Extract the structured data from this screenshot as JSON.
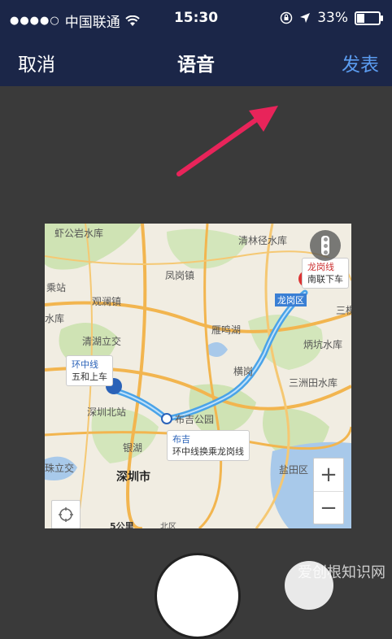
{
  "status_bar": {
    "signal": "●●●●○",
    "carrier": "中国联通",
    "time": "15:30",
    "battery": "33%",
    "battery_level": 0.33
  },
  "nav": {
    "cancel": "取消",
    "title": "语音",
    "publish": "发表"
  },
  "map": {
    "places": {
      "p1": "虾公岩水库",
      "p2": "清林径水库",
      "p3": "凤岗镇",
      "p4": "观澜镇",
      "p5": "水库",
      "p6": "雁鸣湖",
      "p7": "炳坑水库",
      "p8": "清湖立交",
      "p9": "横岗",
      "p10": "三洲田水库",
      "p11": "深圳北站",
      "p12": "布吉公园",
      "p13": "银湖",
      "p14": "深圳市",
      "p15": "盐田区",
      "p16": "龙岗区",
      "p17": "三棵",
      "p18": "珠立交",
      "p19": "乘站",
      "p20": "北区"
    },
    "callout_start": {
      "line": "环中线",
      "station": "五和上车"
    },
    "callout_end": {
      "line": "龙岗线",
      "station": "南联下车"
    },
    "callout_transfer": {
      "line": "布吉",
      "detail": "环中线换乘龙岗线"
    },
    "zoom_in": "+",
    "zoom_out": "−",
    "scale": "5公里"
  },
  "watermark": "爱创根知识网",
  "colors": {
    "nav_bg": "#1b2648",
    "accent": "#5b9cf0",
    "arrow": "#e8245a",
    "route": "#4aa3e8"
  }
}
